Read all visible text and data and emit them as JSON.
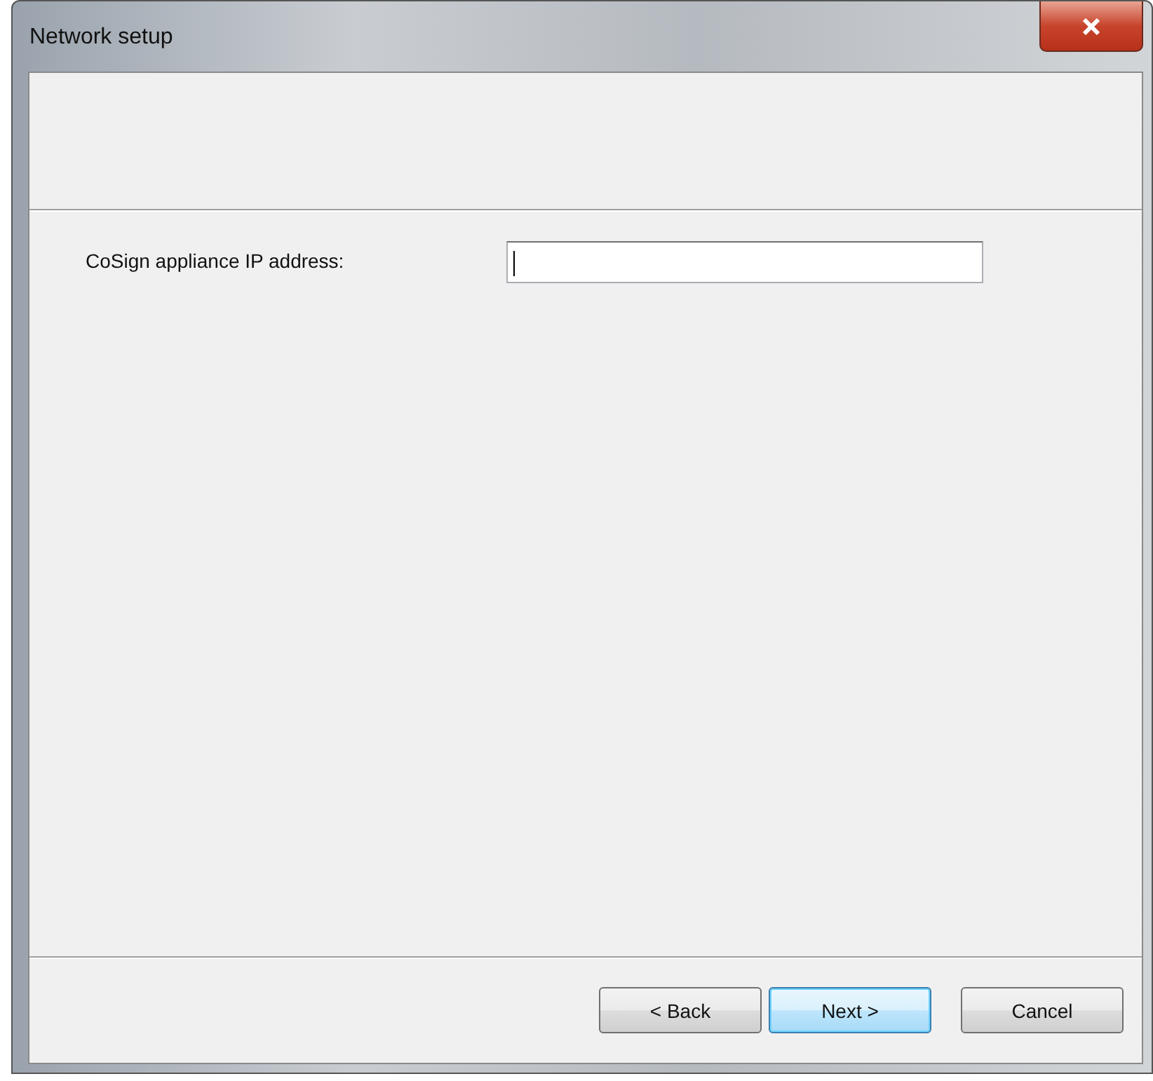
{
  "window": {
    "title": "Network setup"
  },
  "form": {
    "label": "CoSign appliance IP address:"
  },
  "buttons": [
    {
      "label": "< Back",
      "focused": false
    },
    {
      "label": "Next >",
      "focused": true
    },
    {
      "label": "Cancel",
      "focused": false
    }
  ]
}
